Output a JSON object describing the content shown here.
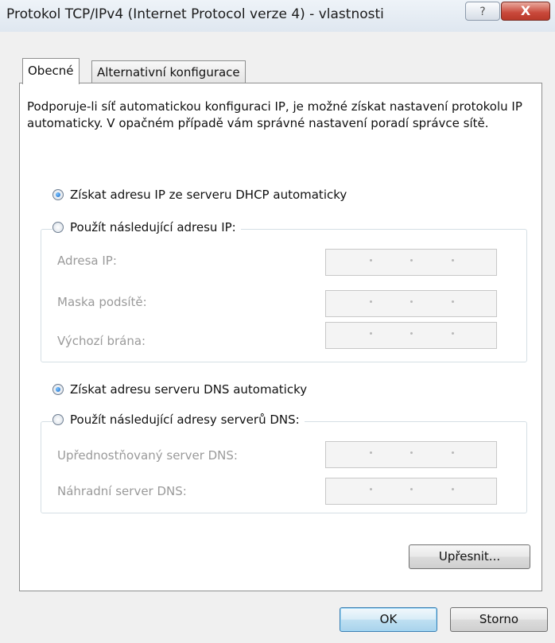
{
  "window": {
    "title": "Protokol TCP/IPv4 (Internet Protocol verze 4) - vlastnosti",
    "help_label": "?",
    "close_label": "X"
  },
  "tabs": [
    {
      "label": "Obecné",
      "selected": true
    },
    {
      "label": "Alternativní konfigurace",
      "selected": false
    }
  ],
  "general": {
    "description": "Podporuje-li síť automatickou konfiguraci IP, je možné získat nastavení protokolu IP automaticky. V opačném případě vám správné nastavení poradí správce sítě.",
    "ip_auto_label": "Získat adresu IP ze serveru DHCP automaticky",
    "ip_manual_label": "Použít následující adresu IP:",
    "ip_fields": [
      {
        "label": "Adresa IP:",
        "value": ""
      },
      {
        "label": "Maska podsítě:",
        "value": ""
      },
      {
        "label": "Výchozí brána:",
        "value": ""
      }
    ],
    "dns_auto_label": "Získat adresu serveru DNS automaticky",
    "dns_manual_label": "Použít následující adresy serverů DNS:",
    "dns_fields": [
      {
        "label": "Upřednostňovaný server DNS:",
        "value": ""
      },
      {
        "label": "Náhradní server DNS:",
        "value": ""
      }
    ],
    "advanced_label": "Upřesnit..."
  },
  "buttons": {
    "ok_label": "OK",
    "cancel_label": "Storno"
  },
  "state": {
    "ip_mode": "auto",
    "dns_mode": "auto"
  }
}
